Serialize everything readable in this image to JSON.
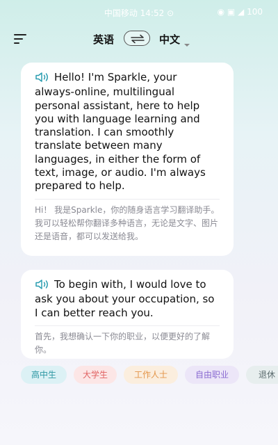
{
  "status_bar": {
    "center": "中国移动 14:52 ⊙",
    "right": "◉ ▣ ◢ 100"
  },
  "header": {
    "source_language": "英语",
    "target_language": "中文"
  },
  "messages": [
    {
      "english": "Hello! I'm Sparkle, your always-online, multilingual personal assistant, here to help you with language learning and translation. I can smoothly translate between many languages, in either the form of text, image, or audio. I'm always prepared to help.",
      "chinese": "Hi！ 我是Sparkle，你的随身语言学习翻译助手。我可以轻松帮你翻译多种语言，无论是文字、图片还是语音，都可以发送给我。"
    },
    {
      "english": "To begin with, I would love to ask you about your occupation, so I can better reach you.",
      "chinese": "首先，我想确认一下你的职业，以便更好的了解你。"
    }
  ],
  "occupation_chips": [
    {
      "label": "高中生",
      "color": "#2d97a3"
    },
    {
      "label": "大学生",
      "color": "#e06262"
    },
    {
      "label": "工作人士",
      "color": "#e39549"
    },
    {
      "label": "自由职业",
      "color": "#8a6bd1"
    },
    {
      "label": "退休",
      "color": "#5b6b6e"
    }
  ],
  "colors": {
    "accent": "#2a9db0",
    "background_top": "#cfeee9",
    "card": "#ffffff"
  }
}
